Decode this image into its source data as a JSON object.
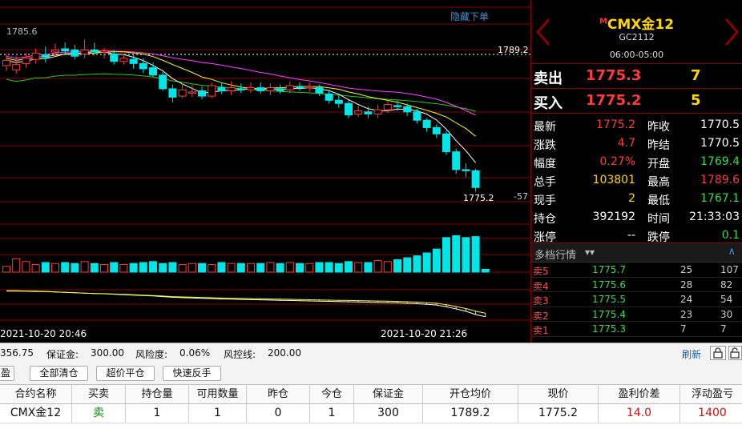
{
  "chart": {
    "hide_menu_label": "隐藏下单",
    "price_hi": "1785.6",
    "dashed_price": "1789.2",
    "last_price": "1775.2",
    "pct": "-57",
    "time_left": "2021-10-20 20:46",
    "time_right": "2021-10-20 21:26",
    "colors": {
      "up": "#ff3b3b",
      "down": "#00e5e5",
      "ma5": "#ffffff",
      "ma10": "#ffff00",
      "ma20": "#ff40ff",
      "ma60": "#22cc22",
      "grid": "#8b0000"
    },
    "candles": [
      {
        "o": 1786.8,
        "c": 1787.3,
        "h": 1787.9,
        "l": 1786.3
      },
      {
        "o": 1786.4,
        "c": 1786.9,
        "h": 1787.7,
        "l": 1786.0
      },
      {
        "o": 1787.0,
        "c": 1787.5,
        "h": 1788.0,
        "l": 1786.6
      },
      {
        "o": 1787.4,
        "c": 1788.0,
        "h": 1788.4,
        "l": 1787.0
      },
      {
        "o": 1787.8,
        "c": 1787.6,
        "h": 1788.6,
        "l": 1787.1
      },
      {
        "o": 1788.1,
        "c": 1788.3,
        "h": 1788.9,
        "l": 1787.7
      },
      {
        "o": 1788.4,
        "c": 1788.2,
        "h": 1789.0,
        "l": 1787.9
      },
      {
        "o": 1788.3,
        "c": 1787.7,
        "h": 1788.8,
        "l": 1787.4
      },
      {
        "o": 1787.9,
        "c": 1788.3,
        "h": 1789.3,
        "l": 1787.5
      },
      {
        "o": 1788.3,
        "c": 1788.1,
        "h": 1789.0,
        "l": 1787.8
      },
      {
        "o": 1788.1,
        "c": 1788.2,
        "h": 1788.5,
        "l": 1787.5
      },
      {
        "o": 1787.9,
        "c": 1787.2,
        "h": 1788.3,
        "l": 1786.9
      },
      {
        "o": 1787.2,
        "c": 1787.5,
        "h": 1787.9,
        "l": 1786.9
      },
      {
        "o": 1787.4,
        "c": 1787.0,
        "h": 1787.8,
        "l": 1786.5
      },
      {
        "o": 1787.0,
        "c": 1786.5,
        "h": 1787.5,
        "l": 1786.1
      },
      {
        "o": 1786.6,
        "c": 1785.9,
        "h": 1787.1,
        "l": 1785.7
      },
      {
        "o": 1785.9,
        "c": 1784.6,
        "h": 1786.2,
        "l": 1784.4
      },
      {
        "o": 1784.6,
        "c": 1783.8,
        "h": 1785.0,
        "l": 1783.3
      },
      {
        "o": 1783.9,
        "c": 1784.5,
        "h": 1785.1,
        "l": 1783.7
      },
      {
        "o": 1784.3,
        "c": 1784.3,
        "h": 1785.0,
        "l": 1783.8
      },
      {
        "o": 1784.4,
        "c": 1783.9,
        "h": 1784.8,
        "l": 1783.6
      },
      {
        "o": 1783.9,
        "c": 1784.9,
        "h": 1785.2,
        "l": 1783.7
      },
      {
        "o": 1784.7,
        "c": 1784.4,
        "h": 1785.2,
        "l": 1784.1
      },
      {
        "o": 1784.4,
        "c": 1784.7,
        "h": 1785.3,
        "l": 1784.0
      },
      {
        "o": 1784.6,
        "c": 1784.5,
        "h": 1785.1,
        "l": 1784.2
      },
      {
        "o": 1784.5,
        "c": 1784.7,
        "h": 1785.2,
        "l": 1784.2
      },
      {
        "o": 1784.7,
        "c": 1784.4,
        "h": 1785.2,
        "l": 1784.1
      },
      {
        "o": 1784.4,
        "c": 1784.7,
        "h": 1785.1,
        "l": 1784.0
      },
      {
        "o": 1784.6,
        "c": 1784.4,
        "h": 1785.0,
        "l": 1784.1
      },
      {
        "o": 1784.5,
        "c": 1784.9,
        "h": 1785.3,
        "l": 1784.2
      },
      {
        "o": 1784.8,
        "c": 1784.7,
        "h": 1785.2,
        "l": 1784.4
      },
      {
        "o": 1784.7,
        "c": 1784.8,
        "h": 1785.2,
        "l": 1784.3
      },
      {
        "o": 1784.7,
        "c": 1784.2,
        "h": 1785.0,
        "l": 1783.9
      },
      {
        "o": 1784.1,
        "c": 1783.5,
        "h": 1784.5,
        "l": 1783.2
      },
      {
        "o": 1783.5,
        "c": 1783.2,
        "h": 1784.0,
        "l": 1782.8
      },
      {
        "o": 1783.2,
        "c": 1782.1,
        "h": 1783.5,
        "l": 1781.8
      },
      {
        "o": 1782.2,
        "c": 1782.5,
        "h": 1783.0,
        "l": 1781.9
      },
      {
        "o": 1782.4,
        "c": 1782.2,
        "h": 1782.9,
        "l": 1781.8
      },
      {
        "o": 1782.2,
        "c": 1782.6,
        "h": 1783.1,
        "l": 1781.8
      },
      {
        "o": 1782.6,
        "c": 1783.1,
        "h": 1783.5,
        "l": 1782.3
      },
      {
        "o": 1783.0,
        "c": 1782.9,
        "h": 1783.5,
        "l": 1782.5
      },
      {
        "o": 1782.9,
        "c": 1782.4,
        "h": 1783.2,
        "l": 1782.0
      },
      {
        "o": 1782.4,
        "c": 1781.6,
        "h": 1782.7,
        "l": 1781.3
      },
      {
        "o": 1781.6,
        "c": 1780.9,
        "h": 1781.8,
        "l": 1780.5
      },
      {
        "o": 1780.9,
        "c": 1780.3,
        "h": 1781.2,
        "l": 1779.9
      },
      {
        "o": 1780.3,
        "c": 1778.6,
        "h": 1780.6,
        "l": 1778.3
      },
      {
        "o": 1778.6,
        "c": 1776.9,
        "h": 1778.9,
        "l": 1776.5
      },
      {
        "o": 1776.9,
        "c": 1776.8,
        "h": 1777.5,
        "l": 1776.2
      },
      {
        "o": 1776.8,
        "c": 1775.2,
        "h": 1777.0,
        "l": 1774.8
      }
    ],
    "volumes": [
      6,
      14,
      11,
      8,
      10,
      9,
      10,
      9,
      11,
      9,
      8,
      10,
      8,
      9,
      10,
      11,
      9,
      10,
      8,
      9,
      9,
      8,
      10,
      9,
      9,
      9,
      9,
      10,
      9,
      10,
      9,
      9,
      10,
      10,
      9,
      11,
      10,
      10,
      12,
      11,
      13,
      15,
      17,
      20,
      24,
      36,
      38,
      36,
      37,
      3
    ],
    "macd": [
      1.0,
      1.0,
      0.9,
      0.8,
      0.7,
      0.5,
      0.3,
      0.1,
      -0.1,
      -0.3,
      -0.4,
      -0.6,
      -0.8,
      -1.0,
      -1.2,
      -1.4,
      -1.7,
      -2.0,
      -2.2,
      -2.3,
      -2.5,
      -2.6,
      -2.8,
      -2.9,
      -3.0,
      -3.1,
      -3.2,
      -3.3,
      -3.4,
      -3.5,
      -3.6,
      -3.7,
      -3.8,
      -3.9,
      -4.0,
      -4.1,
      -4.2,
      -4.3,
      -4.4,
      -4.5,
      -4.6,
      -4.8,
      -5.0,
      -5.3,
      -5.6,
      -6.4,
      -7.4,
      -8.5,
      -10.0,
      -11.0
    ]
  },
  "quote": {
    "symbol_sup": "M",
    "symbol": "CMX金12",
    "code": "GC2112",
    "hours": "06:00-05:00",
    "sell_label": "卖出",
    "sell_price": "1775.3",
    "sell_vol": "7",
    "buy_label": "买入",
    "buy_price": "1775.2",
    "buy_vol": "5",
    "stats": [
      {
        "k1": "最新",
        "v1": "1775.2",
        "c1": "red",
        "k2": "昨收",
        "v2": "1770.5",
        "c2": "white"
      },
      {
        "k1": "涨跌",
        "v1": "4.7",
        "c1": "red",
        "k2": "昨结",
        "v2": "1770.5",
        "c2": "white"
      },
      {
        "k1": "幅度",
        "v1": "0.27%",
        "c1": "red",
        "k2": "开盘",
        "v2": "1769.4",
        "c2": "green"
      },
      {
        "k1": "总手",
        "v1": "103801",
        "c1": "yellow",
        "k2": "最高",
        "v2": "1789.6",
        "c2": "red"
      },
      {
        "k1": "现手",
        "v1": "2",
        "c1": "yellow",
        "k2": "最低",
        "v2": "1767.1",
        "c2": "green"
      },
      {
        "k1": "持仓",
        "v1": "392192",
        "c1": "white",
        "k2": "时间",
        "v2": "21:33:03",
        "c2": "white"
      },
      {
        "k1": "涨停",
        "v1": "--",
        "c1": "white",
        "k2": "跌停",
        "v2": "0.1",
        "c2": "green"
      }
    ],
    "depth_title": "多档行情",
    "depth": [
      {
        "k": "卖5",
        "p": "1775.7",
        "v": "25",
        "v2": "107"
      },
      {
        "k": "卖4",
        "p": "1775.6",
        "v": "28",
        "v2": "82"
      },
      {
        "k": "卖3",
        "p": "1775.5",
        "v": "24",
        "v2": "54"
      },
      {
        "k": "卖2",
        "p": "1775.4",
        "v": "23",
        "v2": "30"
      },
      {
        "k": "卖1",
        "p": "1775.3",
        "v": "7",
        "v2": "7"
      }
    ]
  },
  "account": {
    "balance": "356.75",
    "margin_label": "保证金:",
    "margin": "300.00",
    "risk_label": "风险度:",
    "risk": "0.06%",
    "line_label": "风控线:",
    "line": "200.00",
    "refresh": "刷新"
  },
  "buttons": {
    "tab_left": "盈",
    "close_all": "全部清仓",
    "over_price": "超价平仓",
    "reverse": "快速反手"
  },
  "table": {
    "headers": [
      "合约名称",
      "买卖",
      "持仓量",
      "可用数量",
      "昨仓",
      "今仓",
      "保证金",
      "开仓均价",
      "现价",
      "盈利价差",
      "浮动盈亏"
    ],
    "row": [
      "CMX金12",
      "卖",
      "1",
      "1",
      "0",
      "1",
      "300",
      "1789.2",
      "1775.2",
      "14.0",
      "1400"
    ]
  }
}
